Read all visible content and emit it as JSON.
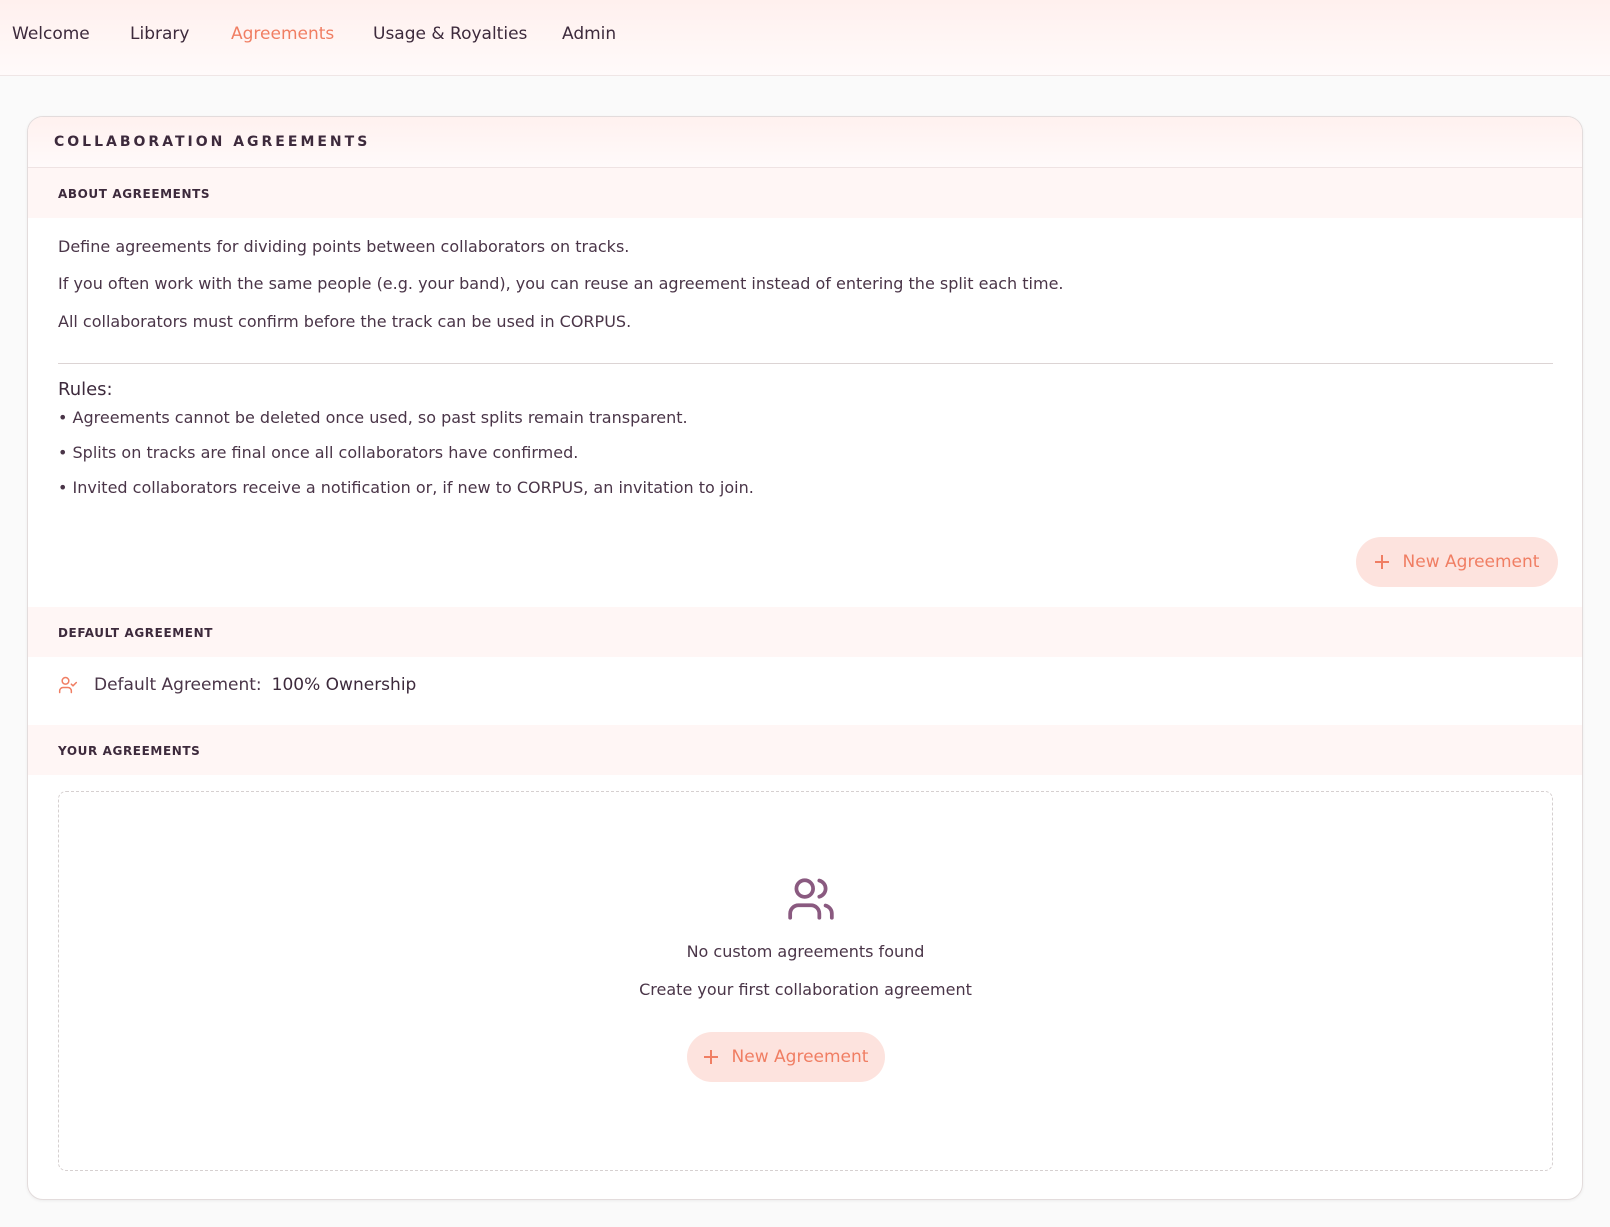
{
  "nav": {
    "items": [
      {
        "label": "Welcome"
      },
      {
        "label": "Library"
      },
      {
        "label": "Agreements"
      },
      {
        "label": "Usage & Royalties"
      },
      {
        "label": "Admin"
      }
    ],
    "active": "Agreements"
  },
  "card": {
    "title": "COLLABORATION AGREEMENTS"
  },
  "about": {
    "label": "ABOUT AGREEMENTS",
    "paragraphs": [
      "Define agreements for dividing points between collaborators on tracks.",
      "If you often work with the same people (e.g. your band), you can reuse an agreement instead of entering the split each time.",
      "All collaborators must confirm before the track can be used in CORPUS."
    ],
    "rules_title": "Rules:",
    "rules": [
      "• Agreements cannot be deleted once used, so past splits remain transparent.",
      "• Splits on tracks are final once all collaborators have confirmed.",
      "• Invited collaborators receive a notification or, if new to CORPUS, an invitation to join."
    ],
    "new_button": "New Agreement"
  },
  "default_agreement": {
    "label": "DEFAULT AGREEMENT",
    "row_label": "Default Agreement:",
    "row_value": "100% Ownership",
    "icon": "user-check-icon"
  },
  "your_agreements": {
    "label": "YOUR AGREEMENTS",
    "empty_icon": "users-icon",
    "empty_title": "No custom agreements found",
    "empty_subtitle": "Create your first collaboration agreement",
    "new_button": "New Agreement"
  },
  "colors": {
    "accent": "#f07e63",
    "button_bg": "#fde3de",
    "text": "#3d2a3c",
    "icon_purple": "#8a5a80"
  }
}
